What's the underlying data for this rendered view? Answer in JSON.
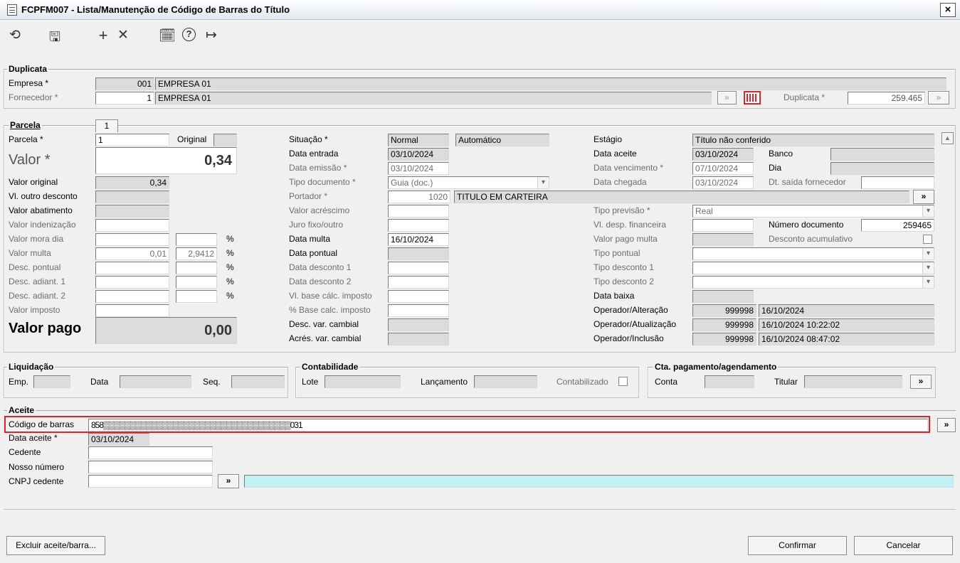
{
  "window": {
    "title": "FCPFM007 - Lista/Manutenção de Código de Barras do Título",
    "close": "×"
  },
  "icons": {
    "refresh": "⟲",
    "save": "🖫",
    "add": "+",
    "delete": "✕",
    "calendar": "🗓",
    "help": "?",
    "exit": "↦",
    "lookup": "»",
    "lookup_disabled": "»"
  },
  "duplicata": {
    "title": "Duplicata",
    "empresa_label": "Empresa *",
    "empresa_code": "001",
    "empresa_name": "EMPRESA 01",
    "fornecedor_label": "Fornecedor *",
    "fornecedor_code": "1",
    "fornecedor_name": "EMPRESA 01",
    "duplicata_label": "Duplicata *",
    "duplicata_value": "259.465"
  },
  "parcela": {
    "title": "Parcela",
    "tab_number": "1",
    "parcela_label": "Parcela *",
    "parcela_value": "1",
    "original_label": "Original",
    "original_value": "",
    "valor_label": "Valor *",
    "valor_value": "0,34",
    "rows_left": [
      {
        "label": "Valor original",
        "value": "0,34",
        "ro": true,
        "dis": false,
        "pct": null
      },
      {
        "label": "Vl. outro desconto",
        "value": "",
        "ro": true,
        "dis": false,
        "pct": null
      },
      {
        "label": "Valor abatimento",
        "value": "",
        "ro": true,
        "dis": false,
        "pct": null
      },
      {
        "label": "Valor indenização",
        "value": "",
        "ro": false,
        "dis": true,
        "pct": null
      },
      {
        "label": "Valor mora dia",
        "value": "",
        "ro": false,
        "dis": true,
        "pct": ""
      },
      {
        "label": "Valor multa",
        "value": "0,01",
        "ro": false,
        "dis": true,
        "pct": "2,9412"
      },
      {
        "label": "Desc. pontual",
        "value": "",
        "ro": false,
        "dis": true,
        "pct": ""
      },
      {
        "label": "Desc. adiant. 1",
        "value": "",
        "ro": false,
        "dis": true,
        "pct": ""
      },
      {
        "label": "Desc. adiant. 2",
        "value": "",
        "ro": false,
        "dis": true,
        "pct": ""
      },
      {
        "label": "Valor imposto",
        "value": "",
        "ro": false,
        "dis": true,
        "pct": null
      }
    ],
    "pct_sign": "%",
    "valor_pago_label": "Valor pago",
    "valor_pago_value": "0,00",
    "situacao_label": "Situação *",
    "situacao_value": "Normal",
    "situacao_extra": "Automático",
    "rows_mid": [
      {
        "label": "Data entrada",
        "value": "03/10/2024",
        "ro": true,
        "dis": false
      },
      {
        "label": "Data emissão *",
        "value": "03/10/2024",
        "ro": false,
        "dis": true
      },
      {
        "label": "Tipo documento *",
        "value": "Guia (doc.)",
        "ro": false,
        "dis": true
      },
      {
        "label": "Portador *",
        "value": "1020",
        "ro": false,
        "dis": true
      },
      {
        "label": "Valor acréscimo",
        "value": "",
        "ro": false,
        "dis": true
      },
      {
        "label": "Juro fixo/outro",
        "value": "",
        "ro": false,
        "dis": true
      },
      {
        "label": "Data multa",
        "value": "16/10/2024",
        "ro": false,
        "dis": false
      },
      {
        "label": "Data pontual",
        "value": "",
        "ro": true,
        "dis": false
      },
      {
        "label": "Data desconto 1",
        "value": "",
        "ro": false,
        "dis": true
      },
      {
        "label": "Data desconto 2",
        "value": "",
        "ro": false,
        "dis": true
      },
      {
        "label": "Vl. base cálc. imposto",
        "value": "",
        "ro": false,
        "dis": true
      },
      {
        "label": "% Base calc. imposto",
        "value": "",
        "ro": false,
        "dis": true
      },
      {
        "label": "Desc. var. cambial",
        "value": "",
        "ro": true,
        "dis": false
      },
      {
        "label": "Acrés. var. cambial",
        "value": "",
        "ro": true,
        "dis": false
      }
    ],
    "portador_name": "TITULO EM CARTEIRA",
    "estagio_label": "Estágio",
    "estagio_value": "Título não conferido",
    "data_aceite_label": "Data aceite",
    "data_aceite_value": "03/10/2024",
    "banco_label": "Banco",
    "banco_value": "",
    "data_venc_label": "Data vencimento *",
    "data_venc_value": "07/10/2024",
    "dia_label": "Dia",
    "dia_value": "",
    "data_chegada_label": "Data chegada",
    "data_chegada_value": "03/10/2024",
    "dt_saida_label": "Dt. saída fornecedor",
    "dt_saida_value": "",
    "tipo_previsao_label": "Tipo previsão *",
    "tipo_previsao_value": "Real",
    "vl_desp_label": "Vl. desp. financeira",
    "vl_desp_value": "",
    "num_doc_label": "Número documento",
    "num_doc_value": "259465",
    "vl_pago_multa_label": "Valor pago multa",
    "vl_pago_multa_value": "",
    "desc_acum_label": "Desconto acumulativo",
    "tipo_pontual_label": "Tipo pontual",
    "tipo_pontual_value": "",
    "tipo_desc1_label": "Tipo desconto 1",
    "tipo_desc1_value": "",
    "tipo_desc2_label": "Tipo desconto 2",
    "tipo_desc2_value": "",
    "data_baixa_label": "Data baixa",
    "data_baixa_value": "",
    "op_alt_label": "Operador/Alteração",
    "op_alt_code": "999998",
    "op_alt_date": "16/10/2024",
    "op_atu_label": "Operador/Atualização",
    "op_atu_code": "999998",
    "op_atu_date": "16/10/2024 10:22:02",
    "op_inc_label": "Operador/Inclusão",
    "op_inc_code": "999998",
    "op_inc_date": "16/10/2024 08:47:02"
  },
  "liquidacao": {
    "title": "Liquidação",
    "emp_label": "Emp.",
    "data_label": "Data",
    "seq_label": "Seq."
  },
  "contabilidade": {
    "title": "Contabilidade",
    "lote_label": "Lote",
    "lanc_label": "Lançamento",
    "contab_label": "Contabilizado"
  },
  "cta": {
    "title": "Cta. pagamento/agendamento",
    "conta_label": "Conta",
    "titular_label": "Titular"
  },
  "aceite": {
    "title": "Aceite",
    "codigo_label": "Código de barras",
    "codigo_value": "858▒▒▒▒▒▒▒▒▒▒▒▒▒▒▒▒▒▒▒▒▒▒▒▒▒▒▒▒▒▒▒▒▒▒▒031",
    "data_aceite_label": "Data aceite *",
    "data_aceite_value": "03/10/2024",
    "cedente_label": "Cedente",
    "cedente_value": "",
    "nosso_label": "Nosso número",
    "nosso_value": "",
    "cnpj_label": "CNPJ cedente",
    "cnpj_value": ""
  },
  "buttons": {
    "excluir": "Excluir aceite/barra...",
    "confirmar": "Confirmar",
    "cancelar": "Cancelar"
  }
}
